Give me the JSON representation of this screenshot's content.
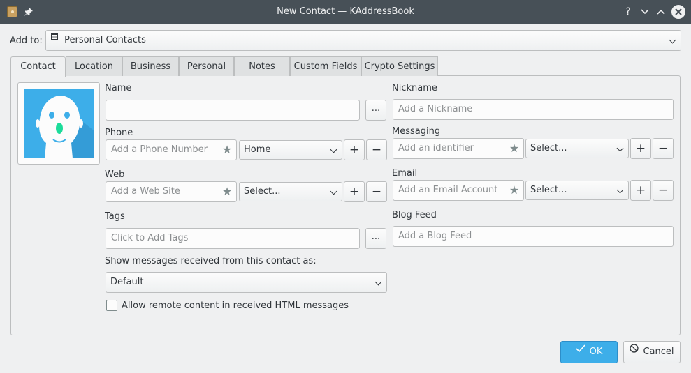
{
  "window": {
    "title": "New Contact — KAddressBook",
    "help_glyph": "?",
    "minimize_glyph": "⌄",
    "maximize_glyph": "⌃"
  },
  "add_to": {
    "label": "Add to:",
    "value": "Personal Contacts"
  },
  "tabs": [
    {
      "label": "Contact"
    },
    {
      "label": "Location"
    },
    {
      "label": "Business"
    },
    {
      "label": "Personal"
    },
    {
      "label": "Notes"
    },
    {
      "label": "Custom Fields"
    },
    {
      "label": "Crypto Settings"
    }
  ],
  "left": {
    "name_label": "Name",
    "name_value": "",
    "ellipsis": "...",
    "phone_label": "Phone",
    "phone_placeholder": "Add a Phone Number",
    "phone_type": "Home",
    "web_label": "Web",
    "web_placeholder": "Add a Web Site",
    "web_type": "Select...",
    "tags_label": "Tags",
    "tags_placeholder": "Click to Add Tags",
    "show_messages_label": "Show messages received from this contact as:",
    "show_messages_value": "Default",
    "allow_remote_label": "Allow remote content in received HTML messages"
  },
  "right": {
    "nickname_label": "Nickname",
    "nickname_placeholder": "Add a Nickname",
    "messaging_label": "Messaging",
    "messaging_placeholder": "Add an identifier",
    "messaging_type": "Select...",
    "email_label": "Email",
    "email_placeholder": "Add an Email Account",
    "email_type": "Select...",
    "blog_label": "Blog Feed",
    "blog_placeholder": "Add a Blog Feed"
  },
  "glyphs": {
    "plus": "+",
    "minus": "−",
    "star": "★"
  },
  "buttons": {
    "ok": "OK",
    "cancel": "Cancel"
  },
  "colors": {
    "accent": "#3daee9",
    "titlebar": "#475057",
    "photo_bg": "#3daee9"
  }
}
